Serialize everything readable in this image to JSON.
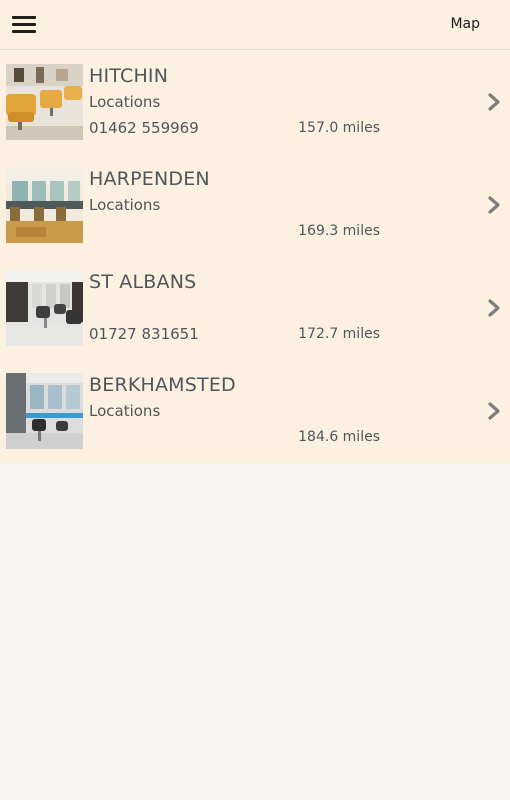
{
  "header": {
    "menu_icon": "hamburger-menu-icon",
    "map_label": "Map"
  },
  "colors": {
    "header_bg": "#fcf1e0",
    "list_bg": "#fcf1e0",
    "page_bg": "#f6f5f2",
    "text": "#4e565c",
    "chevron": "#7d7d7d"
  },
  "locations": [
    {
      "name": "HITCHIN",
      "subtitle": "Locations",
      "phone": "01462 559969",
      "distance": "157.0 miles"
    },
    {
      "name": "HARPENDEN",
      "subtitle": "Locations",
      "phone": "",
      "distance": "169.3 miles"
    },
    {
      "name": "ST ALBANS",
      "subtitle": "",
      "phone": "01727 831651",
      "distance": "172.7 miles"
    },
    {
      "name": "BERKHAMSTED",
      "subtitle": "Locations",
      "phone": "",
      "distance": "184.6 miles"
    }
  ]
}
